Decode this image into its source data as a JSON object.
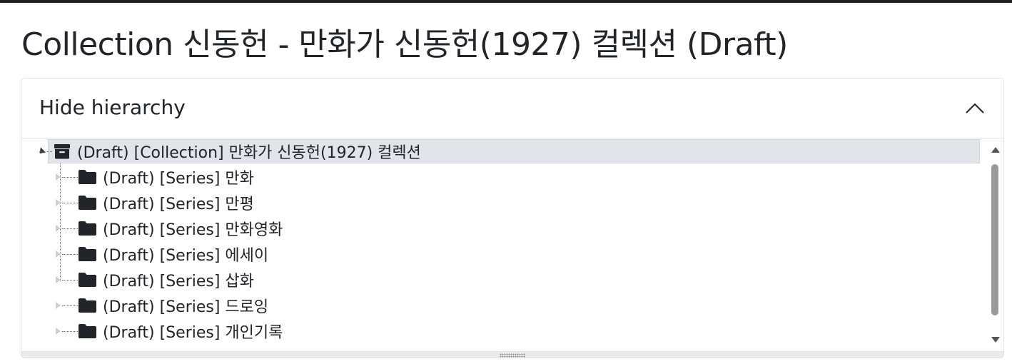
{
  "page": {
    "title": "Collection 신동헌 - 만화가 신동헌(1927) 컬렉션 (Draft)"
  },
  "hierarchy": {
    "toggle_label": "Hide hierarchy",
    "toggle_icon": "chevron-up-icon",
    "root": {
      "label": "(Draft) [Collection] 만화가 신동헌(1927) 컬렉션",
      "icon": "archive-box-icon",
      "expanded": true
    },
    "children": [
      {
        "label": "(Draft) [Series] 만화",
        "icon": "folder-icon"
      },
      {
        "label": "(Draft) [Series] 만평",
        "icon": "folder-icon"
      },
      {
        "label": "(Draft) [Series] 만화영화",
        "icon": "folder-icon"
      },
      {
        "label": "(Draft) [Series] 에세이",
        "icon": "folder-icon"
      },
      {
        "label": "(Draft) [Series] 삽화",
        "icon": "folder-icon"
      },
      {
        "label": "(Draft) [Series] 드로잉",
        "icon": "folder-icon"
      },
      {
        "label": "(Draft) [Series] 개인기록",
        "icon": "folder-icon"
      }
    ]
  },
  "colors": {
    "selected_row_bg": "#e1e4e8",
    "text": "#212529",
    "border": "#dee2e6",
    "top_bar": "#222222"
  }
}
